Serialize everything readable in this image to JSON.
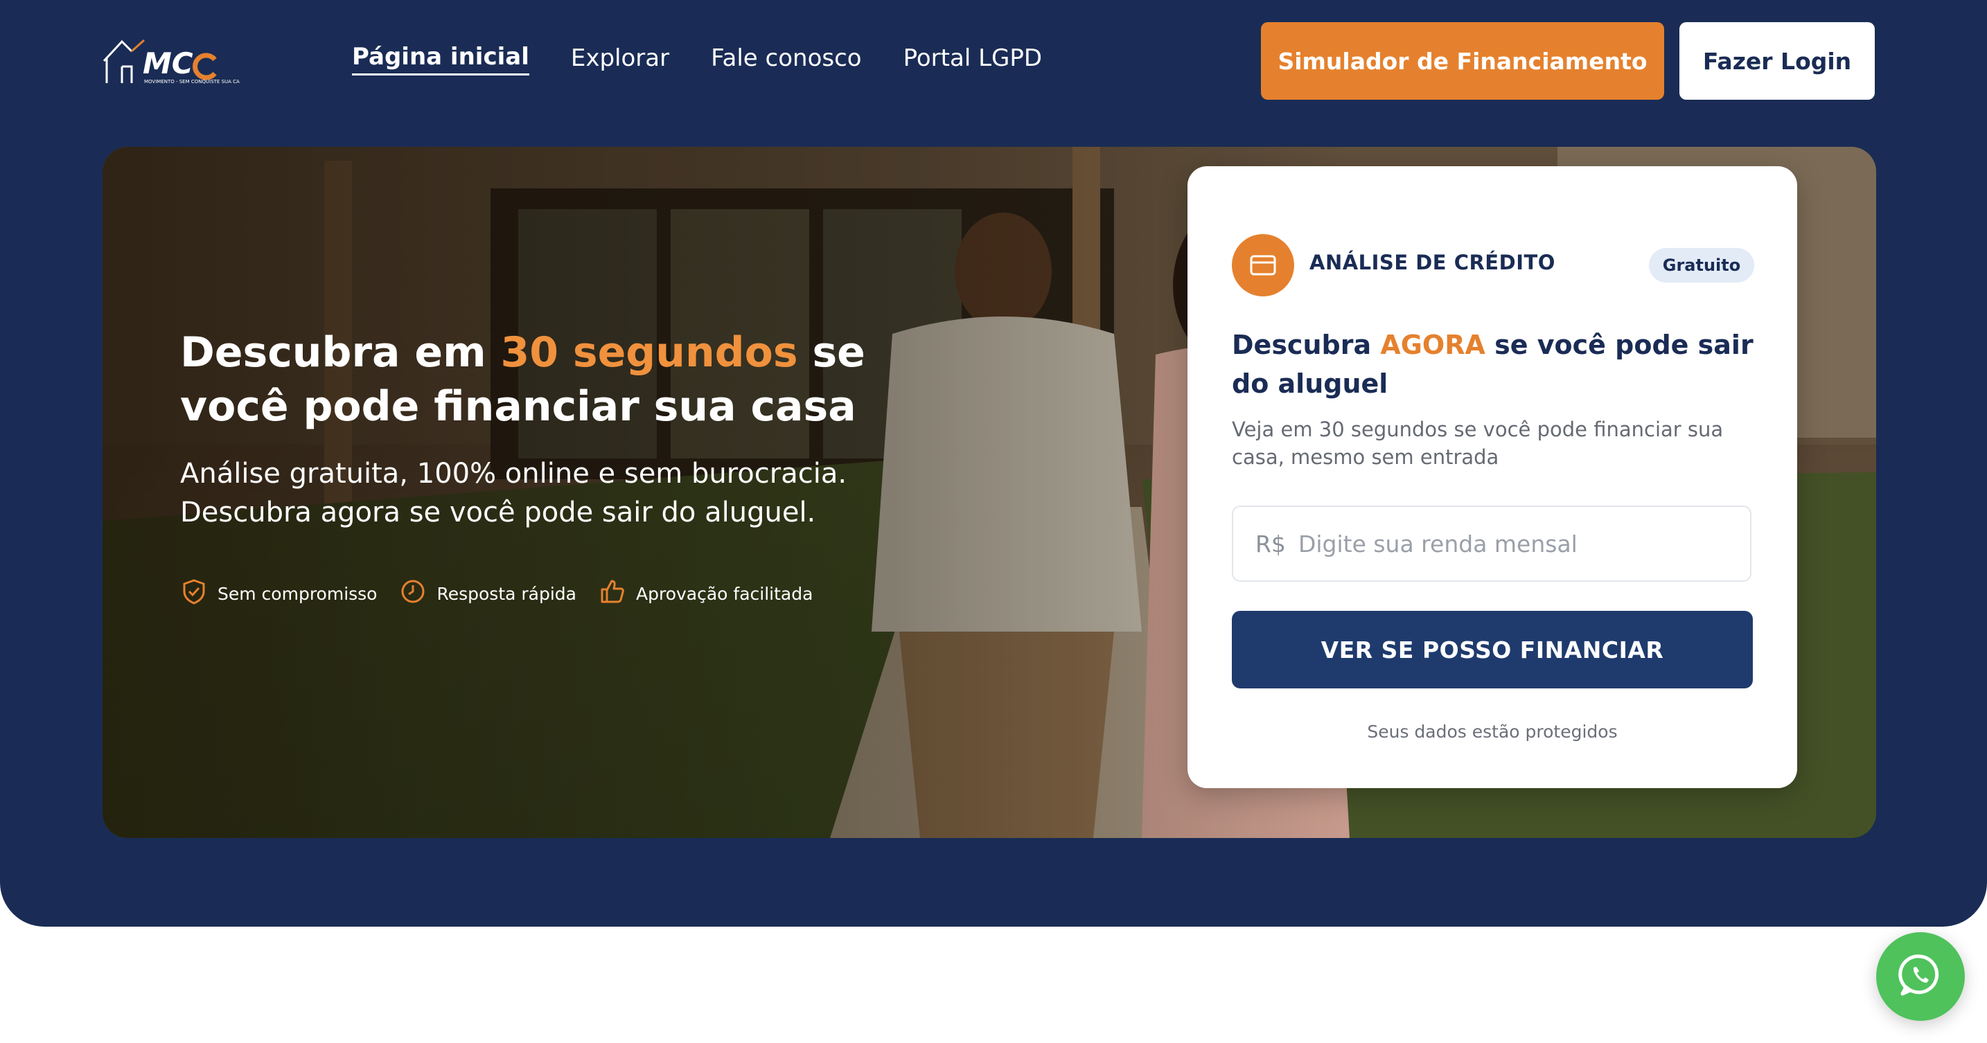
{
  "header": {
    "logo_text": "MCC",
    "logo_tagline": "MOVIMENTO - SEM CONQUISTE SUA CASA",
    "nav": [
      {
        "label": "Página inicial",
        "active": true
      },
      {
        "label": "Explorar",
        "active": false
      },
      {
        "label": "Fale conosco",
        "active": false
      },
      {
        "label": "Portal LGPD",
        "active": false
      }
    ],
    "simulator_button": "Simulador de Financiamento",
    "login_button": "Fazer Login"
  },
  "hero": {
    "title_part1": "Descubra em ",
    "title_highlight": "30 segundos",
    "title_part2": " se você pode financiar sua casa",
    "subtitle_line1": "Análise gratuita, 100% online e sem burocracia.",
    "subtitle_line2": "Descubra agora se você pode sair do aluguel.",
    "badges": [
      {
        "icon": "shield-check-icon",
        "label": "Sem compromisso"
      },
      {
        "icon": "clock-icon",
        "label": "Resposta rápida"
      },
      {
        "icon": "thumbs-up-icon",
        "label": "Aprovação facilitada"
      }
    ]
  },
  "card": {
    "icon": "credit-card-icon",
    "heading": "ANÁLISE DE CRÉDITO",
    "tag": "Gratuito",
    "title_part1": "Descubra ",
    "title_highlight": "AGORA",
    "title_part2": " se você pode sair do aluguel",
    "description": "Veja em 30 segundos se você pode financiar sua casa, mesmo sem entrada",
    "income_prefix": "R$",
    "income_placeholder": "Digite sua renda mensal",
    "income_value": "",
    "cta": "VER SE POSSO FINANCIAR",
    "note": "Seus dados estão protegidos"
  },
  "colors": {
    "navy": "#1a2c55",
    "orange": "#e5812e",
    "button_navy": "#1f3b6d",
    "whatsapp_green": "#4fc25c"
  },
  "floating": {
    "whatsapp_icon": "whatsapp-icon"
  }
}
